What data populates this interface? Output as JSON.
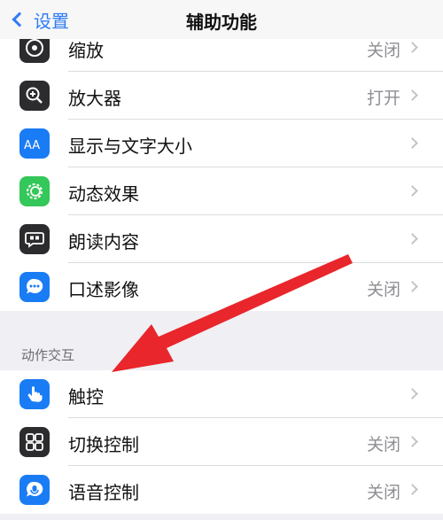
{
  "nav": {
    "back_label": "设置",
    "title": "辅助功能"
  },
  "group1": [
    {
      "label": "缩放",
      "value": "关闭",
      "icon": "zoom-icon",
      "color": "#2c2c2e"
    },
    {
      "label": "放大器",
      "value": "打开",
      "icon": "magnifier-icon",
      "color": "#2c2c2e"
    },
    {
      "label": "显示与文字大小",
      "value": "",
      "icon": "text-size-icon",
      "color": "#1a7cf5"
    },
    {
      "label": "动态效果",
      "value": "",
      "icon": "motion-icon",
      "color": "#34c759"
    },
    {
      "label": "朗读内容",
      "value": "",
      "icon": "spoken-content-icon",
      "color": "#2c2c2e"
    },
    {
      "label": "口述影像",
      "value": "关闭",
      "icon": "audio-description-icon",
      "color": "#1a7cf5"
    }
  ],
  "section2": {
    "header": "动作交互"
  },
  "group2": [
    {
      "label": "触控",
      "value": "",
      "icon": "touch-icon",
      "color": "#1a7cf5"
    },
    {
      "label": "切换控制",
      "value": "关闭",
      "icon": "switch-control-icon",
      "color": "#2c2c2e"
    },
    {
      "label": "语音控制",
      "value": "关闭",
      "icon": "voice-control-icon",
      "color": "#1a7cf5"
    }
  ],
  "annotation": {
    "color": "#e8262b"
  }
}
